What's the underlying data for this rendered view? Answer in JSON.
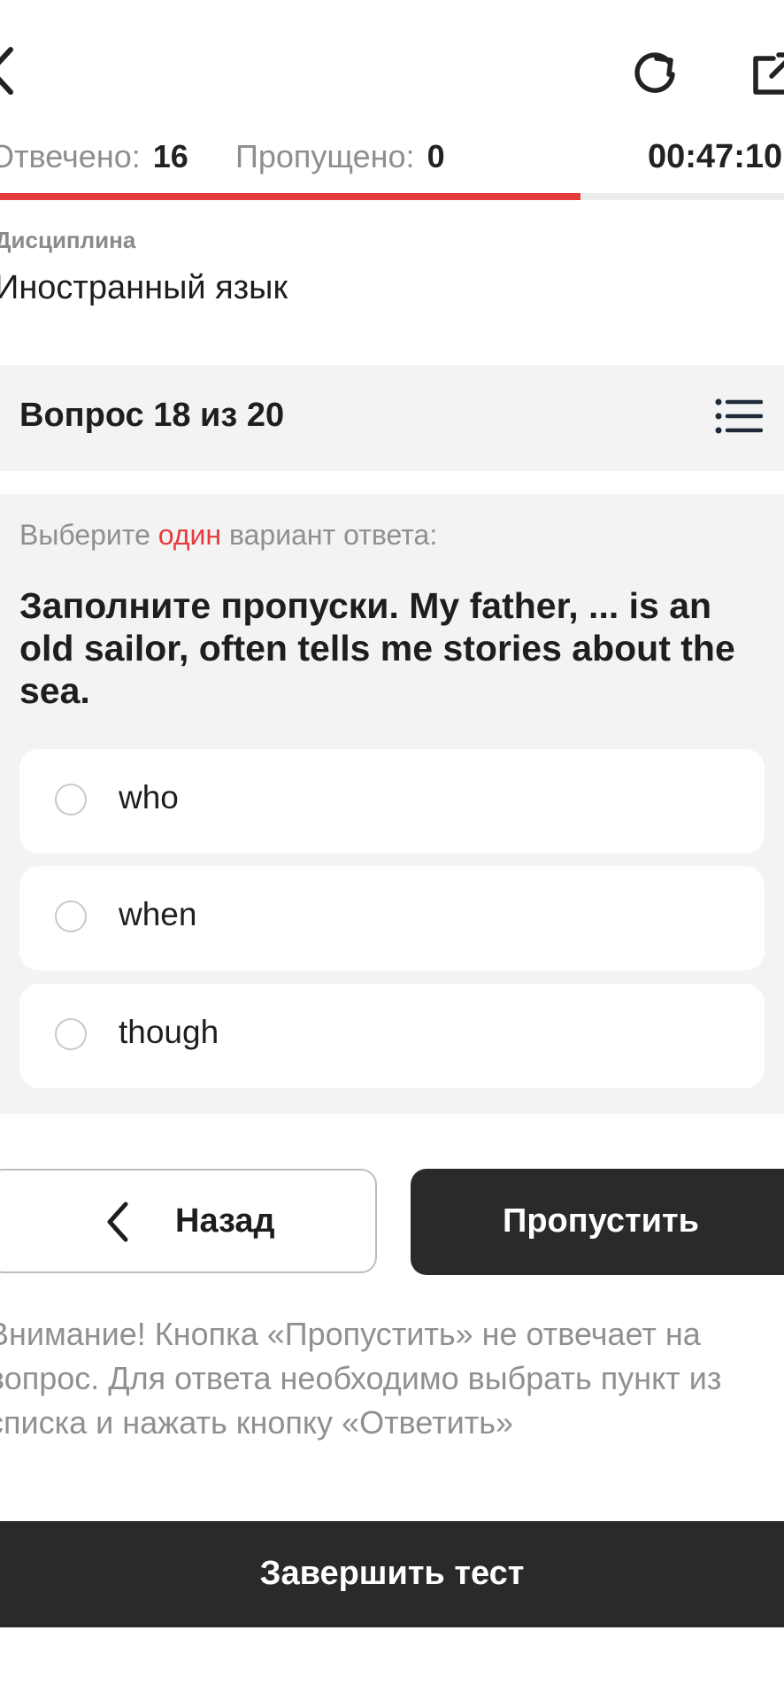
{
  "header": {
    "stats": {
      "answered_label": "Отвечено:",
      "answered_value": "16",
      "skipped_label": "Пропущено:",
      "skipped_value": "0"
    },
    "timer": "00:47:10",
    "progress_fraction": 0.8
  },
  "discipline": {
    "label": "Дисциплина",
    "name": "Иностранный язык"
  },
  "question": {
    "counter": "Вопрос 18 из 20",
    "instruction_before": "Выберите ",
    "instruction_accent": "один",
    "instruction_after": " вариант ответа:",
    "text": "Заполните пропуски. My father, ... is an old sailor, often tells me stories about the sea.",
    "options": [
      "who",
      "when",
      "though"
    ]
  },
  "buttons": {
    "back": "Назад",
    "skip": "Пропустить",
    "finish": "Завершить тест"
  },
  "warning": "Внимание! Кнопка «Пропустить» не отвечает на вопрос. Для ответа необходимо выбрать пункт из списка и нажать кнопку «Ответить»",
  "colors": {
    "accent": "#e63c3c",
    "dark_button": "#2a2a2a",
    "card_bg": "#f3f3f3"
  },
  "icons": [
    "chevron-left-icon",
    "reload-icon",
    "external-link-icon",
    "list-icon"
  ]
}
